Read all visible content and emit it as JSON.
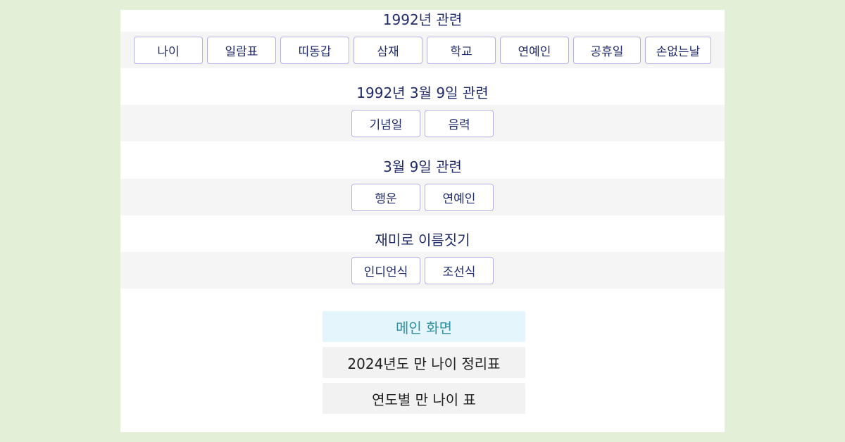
{
  "sections": [
    {
      "title": "1992년 관련",
      "buttons": [
        "나이",
        "일람표",
        "띠동갑",
        "삼재",
        "학교",
        "연예인",
        "공휴일",
        "손없는날"
      ]
    },
    {
      "title": "1992년 3월 9일 관련",
      "buttons": [
        "기념일",
        "음력"
      ]
    },
    {
      "title": "3월 9일 관련",
      "buttons": [
        "행운",
        "연예인"
      ]
    },
    {
      "title": "재미로 이름짓기",
      "buttons": [
        "인디언식",
        "조선식"
      ]
    }
  ],
  "nav": {
    "main": "메인 화면",
    "age_table_2024": "2024년도 만 나이 정리표",
    "yearly_age_table": "연도별 만 나이 표"
  },
  "colors": {
    "page_background": "#e3efd6",
    "panel_background": "#ffffff",
    "band_background": "#f5f5f5",
    "button_border": "#b3b0e6",
    "text_navy": "#1f2a6b",
    "main_button_bg": "#e4f6fc",
    "main_button_text": "#2f8fa6"
  }
}
